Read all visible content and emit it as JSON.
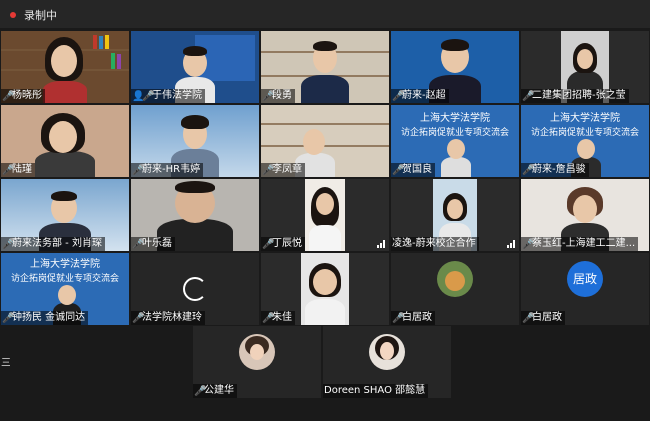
{
  "status_bar": {
    "recording": "录制中"
  },
  "participants": [
    {
      "name": "杨晓彤"
    },
    {
      "name": "于伟法学院"
    },
    {
      "name": "段勇"
    },
    {
      "name": "蔚来-赵超"
    },
    {
      "name": "二建集团招聘-张之莹"
    },
    {
      "name": "陆瑾"
    },
    {
      "name": "蔚来-HR韦婷"
    },
    {
      "name": "李凤章"
    },
    {
      "name": "贺国良"
    },
    {
      "name": "蔚来-詹昌骏"
    },
    {
      "name": "蔚来法务部 - 刘肖琛"
    },
    {
      "name": "叶乐磊"
    },
    {
      "name": "丁辰悦"
    },
    {
      "name": "凌逸-蔚来校企合作"
    },
    {
      "name": "蔡玉红-上海建工二建..."
    },
    {
      "name": "钟扬民 金诚同达"
    },
    {
      "name": "法学院林建玲"
    },
    {
      "name": "朱佳"
    },
    {
      "name": "白居政"
    },
    {
      "name": "白居政",
      "avatar_text": "居政"
    },
    {
      "name": "公建华"
    },
    {
      "name": "Doreen SHAO 邵懿慧"
    }
  ],
  "banners": {
    "school_line1": "上海大学法学院",
    "school_line2": "访企拓岗促就业专项交流会"
  },
  "misc": {
    "left_edge_text": "三"
  }
}
